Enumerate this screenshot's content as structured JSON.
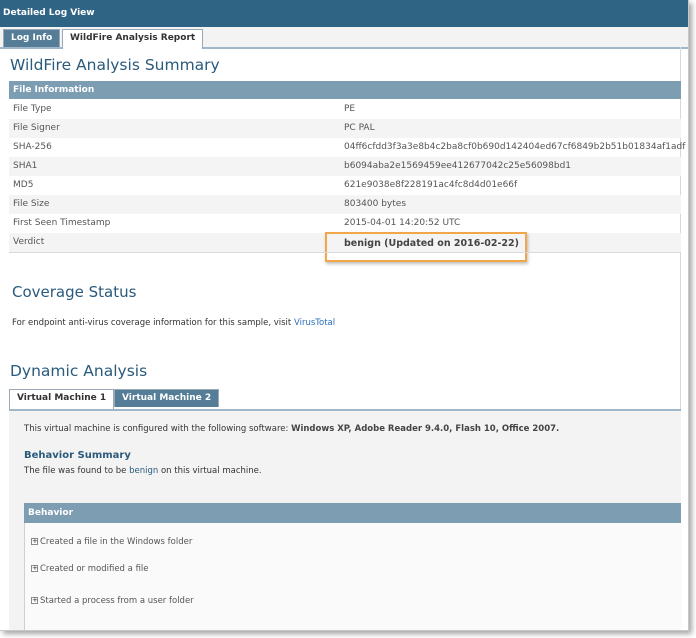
{
  "window": {
    "title": "Detailed Log View"
  },
  "tabs": [
    {
      "label": "Log Info"
    },
    {
      "label": "WildFire Analysis Report"
    }
  ],
  "summary": {
    "heading": "WildFire Analysis Summary"
  },
  "file_information": {
    "header": "File Information",
    "rows": [
      {
        "label": "File Type",
        "value": "PE"
      },
      {
        "label": "File Signer",
        "value": "PC PAL"
      },
      {
        "label": "SHA-256",
        "value": "04ff6cfdd3f3a3e8b4c2ba8cf0b690d142404ed67cf6849b2b51b01834af1adf"
      },
      {
        "label": "SHA1",
        "value": "b6094aba2e1569459ee412677042c25e56098bd1"
      },
      {
        "label": "MD5",
        "value": "621e9038e8f228191ac4fc8d4d01e66f"
      },
      {
        "label": "File Size",
        "value": "803400 bytes"
      },
      {
        "label": "First Seen Timestamp",
        "value": "2015-04-01 14:20:52 UTC"
      },
      {
        "label": "Verdict",
        "value": "benign (Updated on 2016-02-22)"
      }
    ],
    "highlight_color": "#f2a64a"
  },
  "coverage": {
    "heading": "Coverage Status",
    "text": "For endpoint anti-virus coverage information for this sample, visit",
    "link": "VirusTotal"
  },
  "dynamic": {
    "heading": "Dynamic Analysis",
    "vm_tabs": [
      {
        "label": "Virtual Machine 1"
      },
      {
        "label": "Virtual Machine 2"
      }
    ],
    "config_prefix": "This virtual machine is configured with the following software:",
    "config_software": "Windows XP, Adobe Reader 9.4.0, Flash 10, Office 2007.",
    "behavior_summary_title": "Behavior Summary",
    "behavior_text_prefix": "The file was found to be",
    "behavior_verdict": "benign",
    "behavior_text_suffix": "on this virtual machine.",
    "behavior_header": "Behavior",
    "behaviors": [
      {
        "label": "Created a file in the Windows folder"
      },
      {
        "label": "Created or modified a file"
      },
      {
        "label": "Started a process from a user folder"
      }
    ]
  },
  "colors": {
    "titlebar": "#2f6485",
    "section_header": "#7d9db3",
    "heading_text": "#2a5a7c",
    "link": "#2a6ebb"
  }
}
